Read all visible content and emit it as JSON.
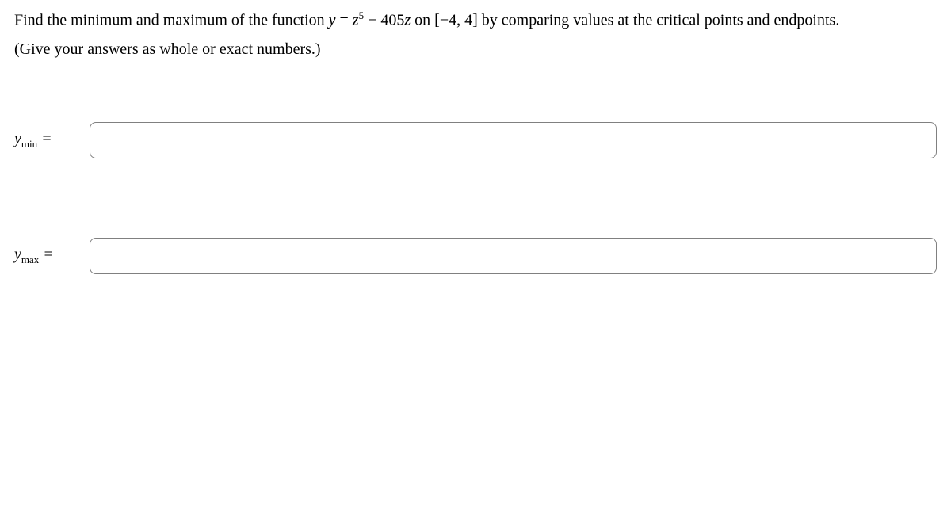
{
  "problem": {
    "text_before_equation": "Find the minimum and maximum of the function ",
    "y_equals": "y",
    "equals": " = ",
    "z_var": "z",
    "exponent": "5",
    "minus": " − 405",
    "z_var2": "z",
    "on_text": " on [−4, 4] by comparing values at the critical points and endpoints."
  },
  "instruction": "(Give your answers as whole or exact numbers.)",
  "answers": {
    "ymin": {
      "label_y": "y",
      "label_sub": "min",
      "label_eq": " = ",
      "value": ""
    },
    "ymax": {
      "label_y": "y",
      "label_sub": "max",
      "label_eq": " = ",
      "value": ""
    }
  }
}
